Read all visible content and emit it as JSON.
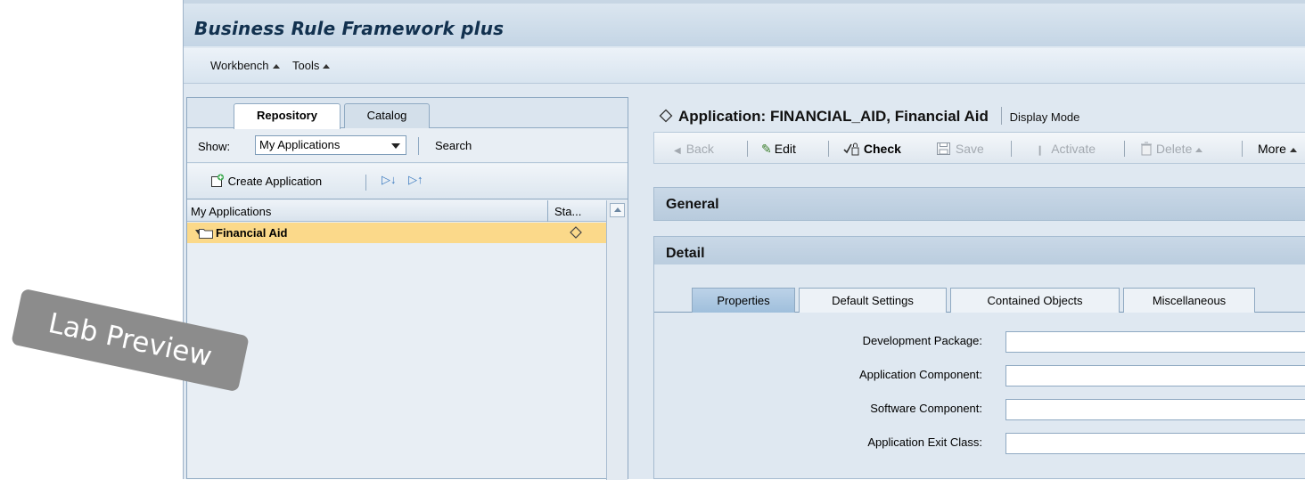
{
  "app": {
    "title": "Business Rule Framework plus"
  },
  "menubar": {
    "items": [
      "Workbench",
      "Tools"
    ]
  },
  "left_panel": {
    "tabs": [
      "Repository",
      "Catalog"
    ],
    "show_label": "Show:",
    "show_value": "My Applications",
    "search_label": "Search",
    "create_button": "Create Application",
    "table": {
      "columns": [
        "My Applications",
        "Sta..."
      ],
      "rows": [
        {
          "name": "Financial Aid",
          "status_icon": "diamond-icon"
        }
      ]
    }
  },
  "right_panel": {
    "header": "Application: FINANCIAL_AID, Financial Aid",
    "mode": "Display Mode",
    "toolbar": {
      "back": "Back",
      "edit": "Edit",
      "check": "Check",
      "save": "Save",
      "activate": "Activate",
      "delete": "Delete",
      "more": "More"
    },
    "sections": {
      "general": "General",
      "detail": "Detail"
    },
    "detail_tabs": [
      "Properties",
      "Default Settings",
      "Contained Objects",
      "Miscellaneous"
    ],
    "fields": [
      {
        "label": "Development Package:",
        "value": ""
      },
      {
        "label": "Application Component:",
        "value": ""
      },
      {
        "label": "Software Component:",
        "value": ""
      },
      {
        "label": "Application Exit Class:",
        "value": ""
      }
    ]
  },
  "watermark": "Lab Preview",
  "colors": {
    "selected_row": "#fbd98a",
    "active_tab": "#a9c6e2",
    "title_text": "#12314f"
  }
}
